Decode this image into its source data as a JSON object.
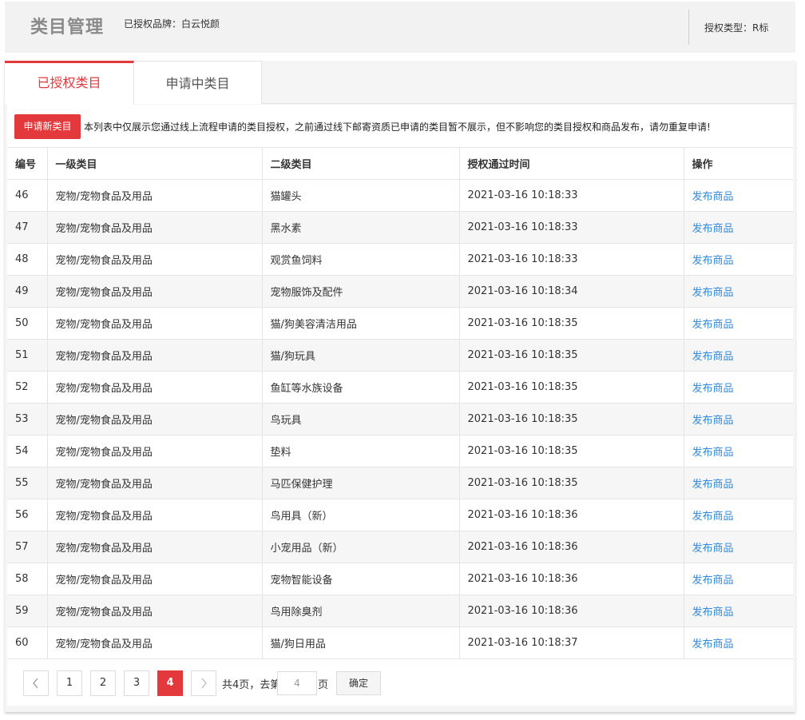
{
  "header": {
    "title": "类目管理",
    "brand": "已授权品牌：白云悦颜",
    "auth_type": "授权类型：R标"
  },
  "tabs": [
    {
      "label": "已授权类目",
      "active": true
    },
    {
      "label": "申请中类目",
      "active": false
    }
  ],
  "notice": {
    "apply_button": "申请新类目",
    "text": "本列表中仅展示您通过线上流程申请的类目授权，之前通过线下邮寄资质已申请的类目暂不展示，但不影响您的类目授权和商品发布，请勿重复申请!"
  },
  "table": {
    "headers": [
      "编号",
      "一级类目",
      "二级类目",
      "授权通过时间",
      "操作"
    ],
    "rows": [
      {
        "id": "46",
        "level1": "宠物/宠物食品及用品",
        "level2": "猫罐头",
        "time": "2021-03-16 10:18:33",
        "action": "发布商品"
      },
      {
        "id": "47",
        "level1": "宠物/宠物食品及用品",
        "level2": "黑水素",
        "time": "2021-03-16 10:18:33",
        "action": "发布商品"
      },
      {
        "id": "48",
        "level1": "宠物/宠物食品及用品",
        "level2": "观赏鱼饲料",
        "time": "2021-03-16 10:18:33",
        "action": "发布商品"
      },
      {
        "id": "49",
        "level1": "宠物/宠物食品及用品",
        "level2": "宠物服饰及配件",
        "time": "2021-03-16 10:18:34",
        "action": "发布商品"
      },
      {
        "id": "50",
        "level1": "宠物/宠物食品及用品",
        "level2": "猫/狗美容清洁用品",
        "time": "2021-03-16 10:18:35",
        "action": "发布商品"
      },
      {
        "id": "51",
        "level1": "宠物/宠物食品及用品",
        "level2": "猫/狗玩具",
        "time": "2021-03-16 10:18:35",
        "action": "发布商品"
      },
      {
        "id": "52",
        "level1": "宠物/宠物食品及用品",
        "level2": "鱼缸等水族设备",
        "time": "2021-03-16 10:18:35",
        "action": "发布商品"
      },
      {
        "id": "53",
        "level1": "宠物/宠物食品及用品",
        "level2": "鸟玩具",
        "time": "2021-03-16 10:18:35",
        "action": "发布商品"
      },
      {
        "id": "54",
        "level1": "宠物/宠物食品及用品",
        "level2": "垫料",
        "time": "2021-03-16 10:18:35",
        "action": "发布商品"
      },
      {
        "id": "55",
        "level1": "宠物/宠物食品及用品",
        "level2": "马匹保健护理",
        "time": "2021-03-16 10:18:35",
        "action": "发布商品"
      },
      {
        "id": "56",
        "level1": "宠物/宠物食品及用品",
        "level2": "鸟用具（新）",
        "time": "2021-03-16 10:18:36",
        "action": "发布商品"
      },
      {
        "id": "57",
        "level1": "宠物/宠物食品及用品",
        "level2": "小宠用品（新）",
        "time": "2021-03-16 10:18:36",
        "action": "发布商品"
      },
      {
        "id": "58",
        "level1": "宠物/宠物食品及用品",
        "level2": "宠物智能设备",
        "time": "2021-03-16 10:18:36",
        "action": "发布商品"
      },
      {
        "id": "59",
        "level1": "宠物/宠物食品及用品",
        "level2": "鸟用除臭剂",
        "time": "2021-03-16 10:18:36",
        "action": "发布商品"
      },
      {
        "id": "60",
        "level1": "宠物/宠物食品及用品",
        "level2": "猫/狗日用品",
        "time": "2021-03-16 10:18:37",
        "action": "发布商品"
      }
    ]
  },
  "pagination": {
    "prev_icon": "chevron-left-icon",
    "next_icon": "chevron-right-icon",
    "pages": [
      "1",
      "2",
      "3",
      "4"
    ],
    "current": "4",
    "total_text": "共4页，去第",
    "goto_value": "4",
    "page_unit": "页",
    "confirm_label": "确定"
  },
  "colors": {
    "accent": "#e4393c",
    "link": "#3489d6"
  }
}
